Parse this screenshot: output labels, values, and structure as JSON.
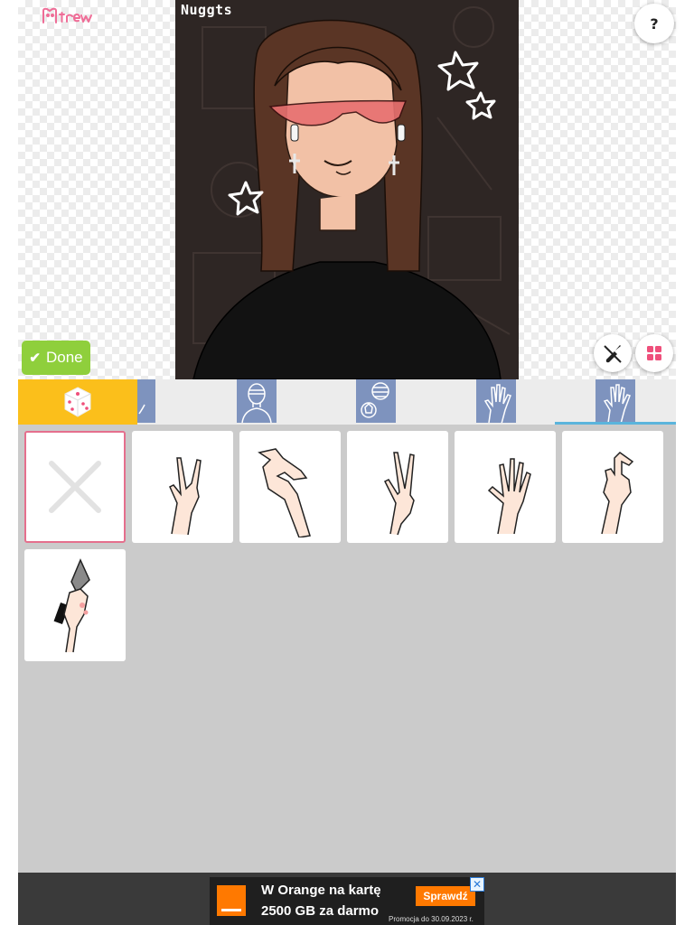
{
  "app": {
    "logo_alt": "Picrew",
    "help_label": "?",
    "done_label": "Done"
  },
  "canvas": {
    "signature": "Nuggts"
  },
  "tabs": [
    {
      "icon": "dice-icon",
      "label": "random"
    },
    {
      "icon": "partial-thumb-icon"
    },
    {
      "icon": "head-outline-icon"
    },
    {
      "icon": "ball-icon"
    },
    {
      "icon": "hand-icon"
    },
    {
      "icon": "hand-icon",
      "active": true
    }
  ],
  "grid": {
    "items": [
      {
        "icon": "none-x-icon",
        "selected": true
      },
      {
        "icon": "rock-hand-icon"
      },
      {
        "icon": "frame-hand-icon"
      },
      {
        "icon": "peace-hand-icon"
      },
      {
        "icon": "open-hand-icon"
      },
      {
        "icon": "pointing-hand-icon"
      },
      {
        "icon": "knife-hand-icon"
      }
    ]
  },
  "ad": {
    "line1": "W Orange na kartę",
    "line2": "2500 GB za darmo",
    "cta": "Sprawdź",
    "fine_print": "Promocja do 30.09.2023 r.",
    "close": "✕"
  },
  "colors": {
    "done": "#8fcf3c",
    "random_tab": "#fbbf1b",
    "tab_thumb": "#7e93be",
    "active_underline": "#5ab4dc",
    "selected_border": "#e56f8d",
    "grid_bg": "#cbcbcb",
    "accent_pink": "#ef4f7b",
    "orange": "#ff7900"
  }
}
